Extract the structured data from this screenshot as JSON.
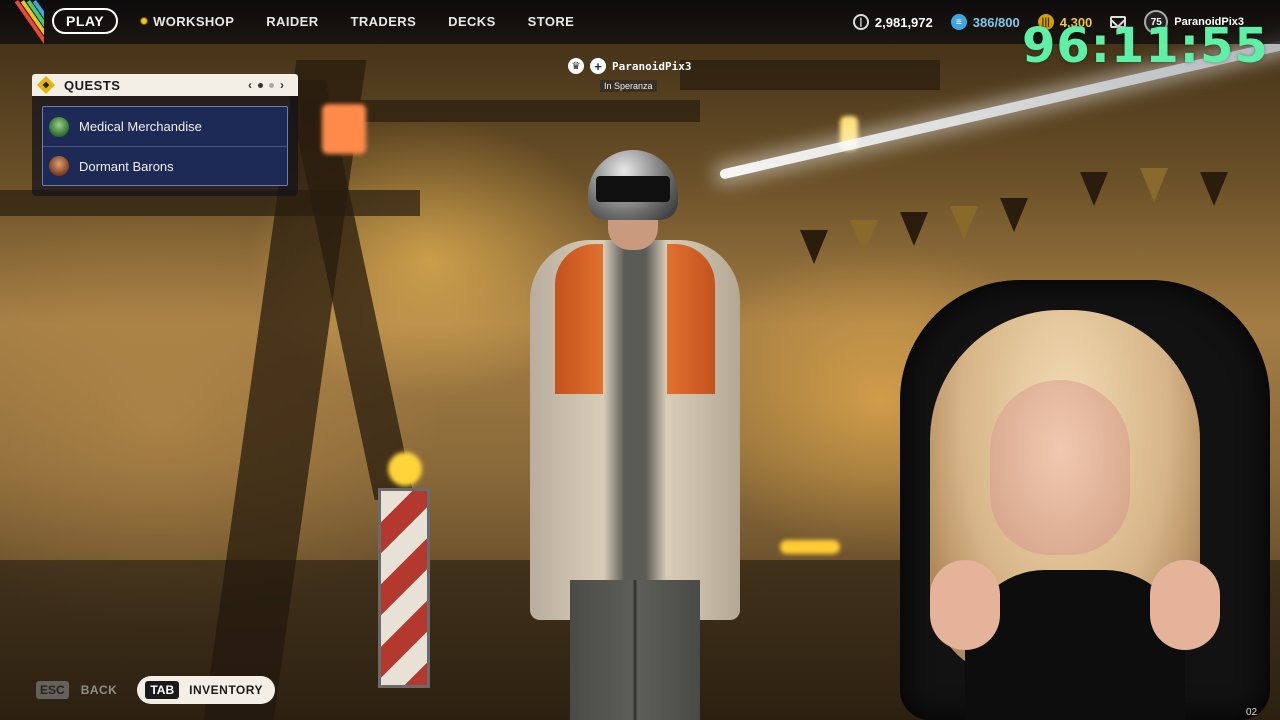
{
  "nav": {
    "play": "PLAY",
    "items": [
      "WORKSHOP",
      "RAIDER",
      "TRADERS",
      "DECKS",
      "STORE"
    ]
  },
  "currencies": {
    "coins": "2,981,972",
    "capacity": "386/800",
    "gold": "4,300"
  },
  "profile": {
    "level": "75",
    "username": "ParanoidPix3"
  },
  "timer": "96:11:55",
  "quests": {
    "title": "QUESTS",
    "items": [
      {
        "label": "Medical Merchandise",
        "icon": "quest-avatar-green"
      },
      {
        "label": "Dormant Barons",
        "icon": "quest-avatar-brown"
      }
    ]
  },
  "player_tag": {
    "name": "ParanoidPix3",
    "status": "In Speranza"
  },
  "controls": {
    "esc_key": "ESC",
    "back": "BACK",
    "tab_key": "TAB",
    "inventory": "INVENTORY"
  },
  "corner_text": "02",
  "colors": {
    "timer": "#5ef0a6",
    "quest_bg": "#1c2a55",
    "accent_yellow": "#e3b60b"
  }
}
